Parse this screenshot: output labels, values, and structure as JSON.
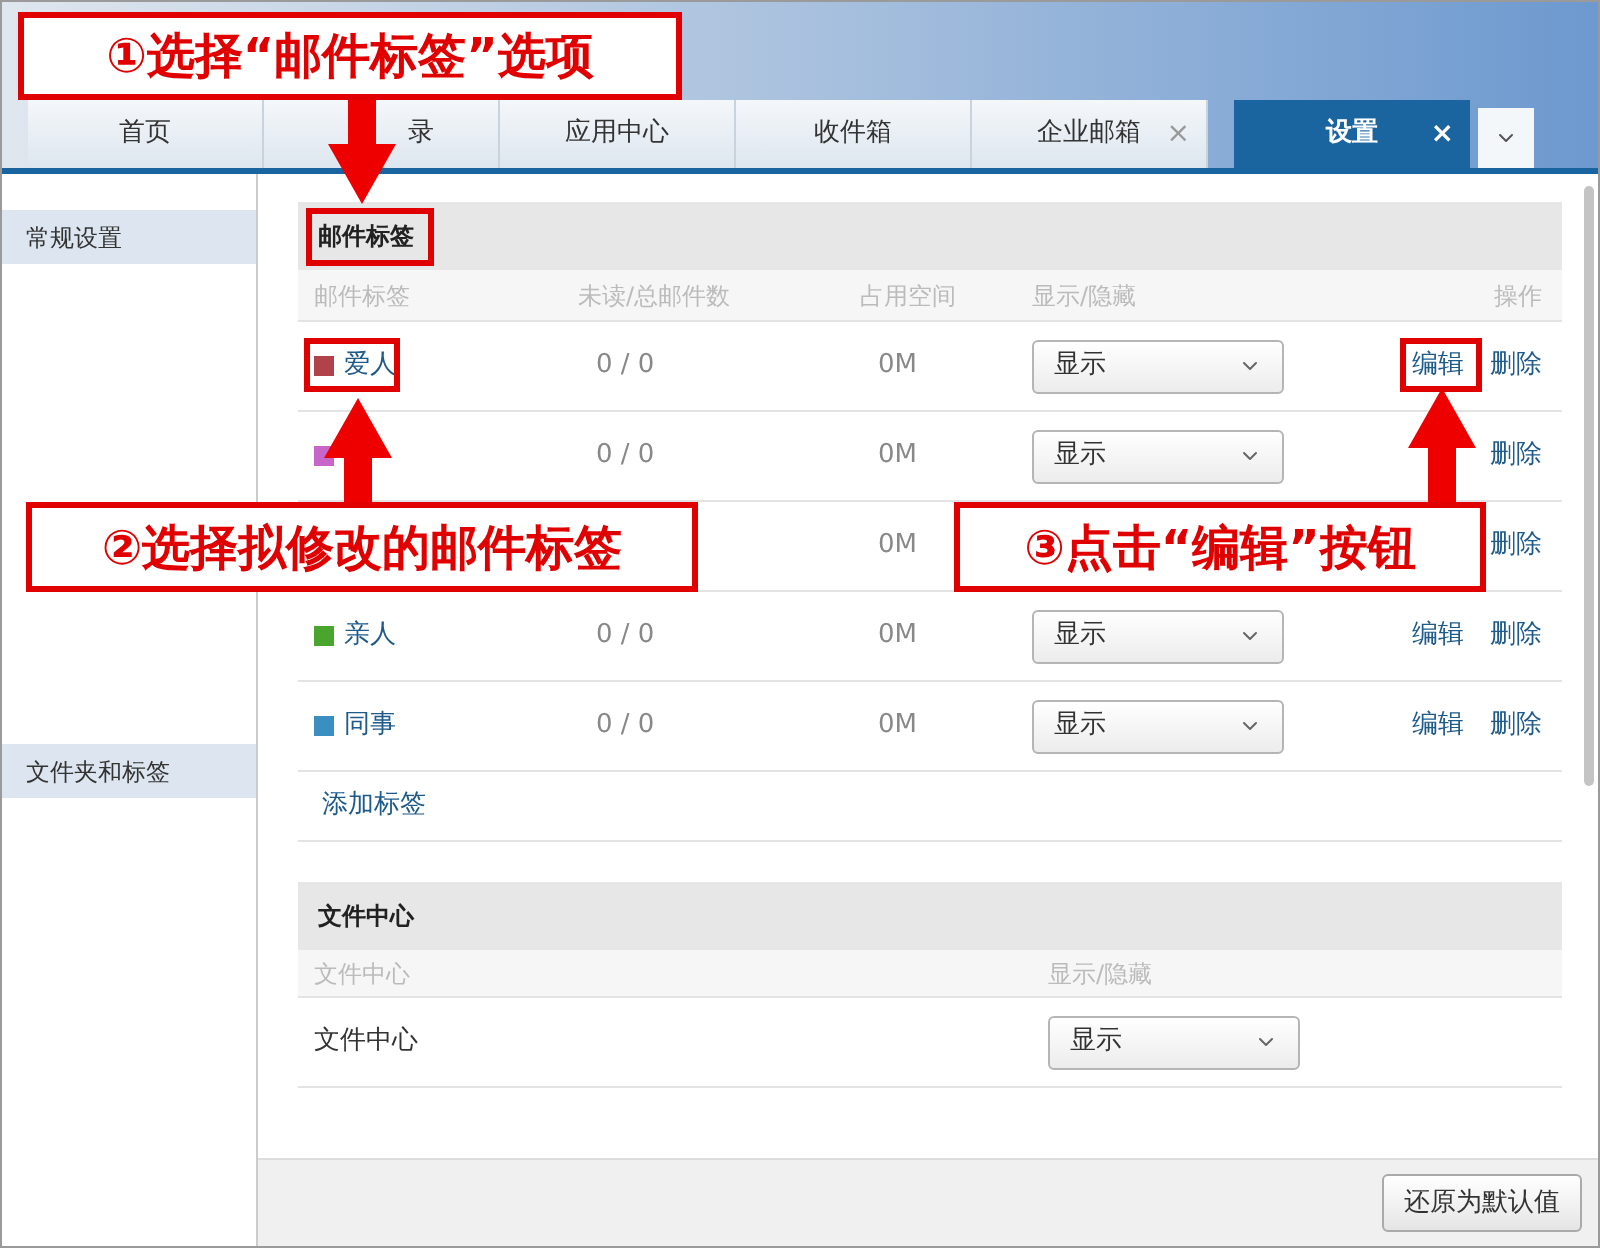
{
  "annotations": [
    {
      "text": "①选择“邮件标签”选项"
    },
    {
      "text": "②选择拟修改的邮件标签"
    },
    {
      "text": "③点击“编辑”按钮"
    }
  ],
  "tabs": [
    {
      "label": "首页",
      "selected": false
    },
    {
      "label": "录",
      "selected": false
    },
    {
      "label": "应用中心",
      "selected": false
    },
    {
      "label": "收件箱",
      "selected": false
    },
    {
      "label": "企业邮箱",
      "selected": false,
      "close": "×"
    },
    {
      "label": "设置",
      "selected": true,
      "close": "×"
    }
  ],
  "sidebar": {
    "items": [
      {
        "label": "常规设置",
        "selected": true
      },
      {
        "label": "文件夹和标签",
        "selected": true
      }
    ]
  },
  "tags_section": {
    "title": "邮件标签",
    "columns": [
      "邮件标签",
      "未读/总邮件数",
      "占用空间",
      "显示/隐藏",
      "操作"
    ],
    "rows": [
      {
        "name": "爱人",
        "color": "#b0434a",
        "counts": "0 / 0",
        "space": "0M",
        "visibility": "显示",
        "edit": "编辑",
        "delete": "删除"
      },
      {
        "color": "#c865c8",
        "counts": "0 / 0",
        "space": "0M",
        "visibility": "显示",
        "delete": "删除"
      },
      {
        "space": "0M",
        "delete": "删除"
      },
      {
        "name": "亲人",
        "color": "#4aa52e",
        "counts": "0 / 0",
        "space": "0M",
        "visibility": "显示",
        "edit": "编辑",
        "delete": "删除"
      },
      {
        "name": "同事",
        "color": "#3a8fc0",
        "counts": "0 / 0",
        "space": "0M",
        "visibility": "显示",
        "edit": "编辑",
        "delete": "删除"
      }
    ],
    "add_link": "添加标签"
  },
  "files_section": {
    "title": "文件中心",
    "columns": [
      "文件中心",
      "显示/隐藏"
    ],
    "rows": [
      {
        "name": "文件中心",
        "visibility": "显示"
      }
    ]
  },
  "footer": {
    "button": "还原为默认值"
  }
}
